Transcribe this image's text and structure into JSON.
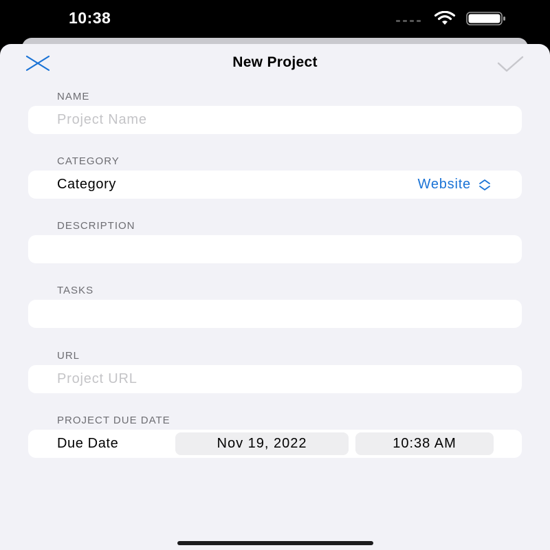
{
  "status_bar": {
    "time": "10:38",
    "icons": [
      "cellular-signal-icon",
      "wifi-icon",
      "battery-icon"
    ]
  },
  "nav": {
    "title": "New Project",
    "close_icon": "close-icon",
    "done_icon": "checkmark-icon"
  },
  "sections": {
    "name": {
      "label": "NAME",
      "placeholder": "Project Name",
      "value": ""
    },
    "category": {
      "label": "CATEGORY",
      "row_label": "Category",
      "selected": "Website",
      "icon": "chevron-up-down-icon"
    },
    "description": {
      "label": "DESCRIPTION",
      "value": ""
    },
    "tasks": {
      "label": "TASKS",
      "value": ""
    },
    "url": {
      "label": "URL",
      "placeholder": "Project URL",
      "value": ""
    },
    "due_date": {
      "label": "PROJECT DUE DATE",
      "row_label": "Due Date",
      "date": "Nov 19, 2022",
      "time": "10:38 AM"
    }
  },
  "colors": {
    "accent": "#1a73d6",
    "background": "#f2f2f7",
    "card": "#ffffff",
    "section_label": "#6d6d72",
    "placeholder": "#c4c4c7",
    "disabled_check": "#c7c7cc"
  }
}
